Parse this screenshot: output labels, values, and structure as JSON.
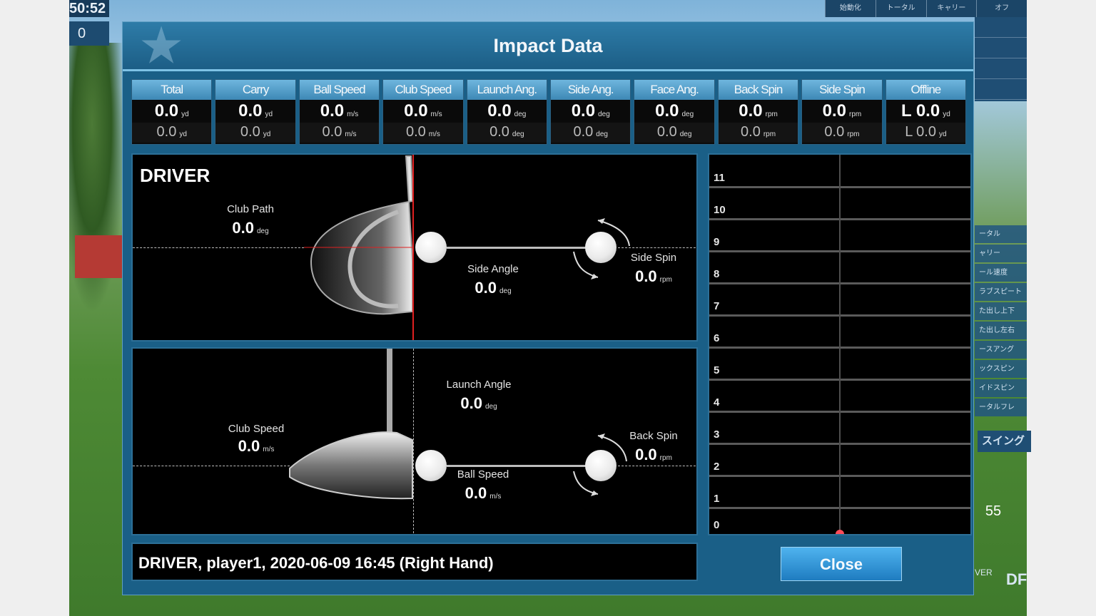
{
  "game_ui": {
    "timer": "50:52",
    "score": "0",
    "top_tabs": [
      "始動化",
      "トータル",
      "キャリー",
      "オフ"
    ],
    "side_list": [
      "ータル",
      "ャリー",
      "ール速度",
      "ラブスピート",
      "た出し上下",
      "た出し左右",
      "ースアング",
      "ックスピン",
      "イドスピン",
      "ータルフレ"
    ],
    "swing_label": "スイング",
    "mini_value": "55",
    "corner_text": "DF",
    "ver_text": "VER"
  },
  "dialog": {
    "title": "Impact Data",
    "stats": [
      {
        "label": "Total",
        "value": "0.0",
        "unit": "yd",
        "prev_value": "0.0",
        "prev_unit": "yd"
      },
      {
        "label": "Carry",
        "value": "0.0",
        "unit": "yd",
        "prev_value": "0.0",
        "prev_unit": "yd"
      },
      {
        "label": "Ball Speed",
        "value": "0.0",
        "unit": "m/s",
        "prev_value": "0.0",
        "prev_unit": "m/s"
      },
      {
        "label": "Club Speed",
        "value": "0.0",
        "unit": "m/s",
        "prev_value": "0.0",
        "prev_unit": "m/s"
      },
      {
        "label": "Launch Ang.",
        "value": "0.0",
        "unit": "deg",
        "prev_value": "0.0",
        "prev_unit": "deg"
      },
      {
        "label": "Side Ang.",
        "value": "0.0",
        "unit": "deg",
        "prev_value": "0.0",
        "prev_unit": "deg"
      },
      {
        "label": "Face Ang.",
        "value": "0.0",
        "unit": "deg",
        "prev_value": "0.0",
        "prev_unit": "deg"
      },
      {
        "label": "Back Spin",
        "value": "0.0",
        "unit": "rpm",
        "prev_value": "0.0",
        "prev_unit": "rpm"
      },
      {
        "label": "Side Spin",
        "value": "0.0",
        "unit": "rpm",
        "prev_value": "0.0",
        "prev_unit": "rpm"
      },
      {
        "label": "Offline",
        "value": "L 0.0",
        "unit": "yd",
        "prev_value": "L 0.0",
        "prev_unit": "yd"
      }
    ],
    "top_view": {
      "club": "DRIVER",
      "club_path_label": "Club Path",
      "club_path_value": "0.0",
      "club_path_unit": "deg",
      "side_angle_label": "Side Angle",
      "side_angle_value": "0.0",
      "side_angle_unit": "deg",
      "side_spin_label": "Side Spin",
      "side_spin_value": "0.0",
      "side_spin_unit": "rpm"
    },
    "side_view": {
      "club_speed_label": "Club Speed",
      "club_speed_value": "0.0",
      "club_speed_unit": "m/s",
      "launch_angle_label": "Launch Angle",
      "launch_angle_value": "0.0",
      "launch_angle_unit": "deg",
      "ball_speed_label": "Ball Speed",
      "ball_speed_value": "0.0",
      "ball_speed_unit": "m/s",
      "back_spin_label": "Back Spin",
      "back_spin_value": "0.0",
      "back_spin_unit": "rpm"
    },
    "shot_chart": {
      "rows": [
        "11",
        "10",
        "9",
        "8",
        "7",
        "6",
        "5",
        "4",
        "3",
        "2",
        "1",
        "0"
      ]
    },
    "info": "DRIVER, player1, 2020-06-09 16:45 (Right Hand)",
    "close_label": "Close"
  }
}
